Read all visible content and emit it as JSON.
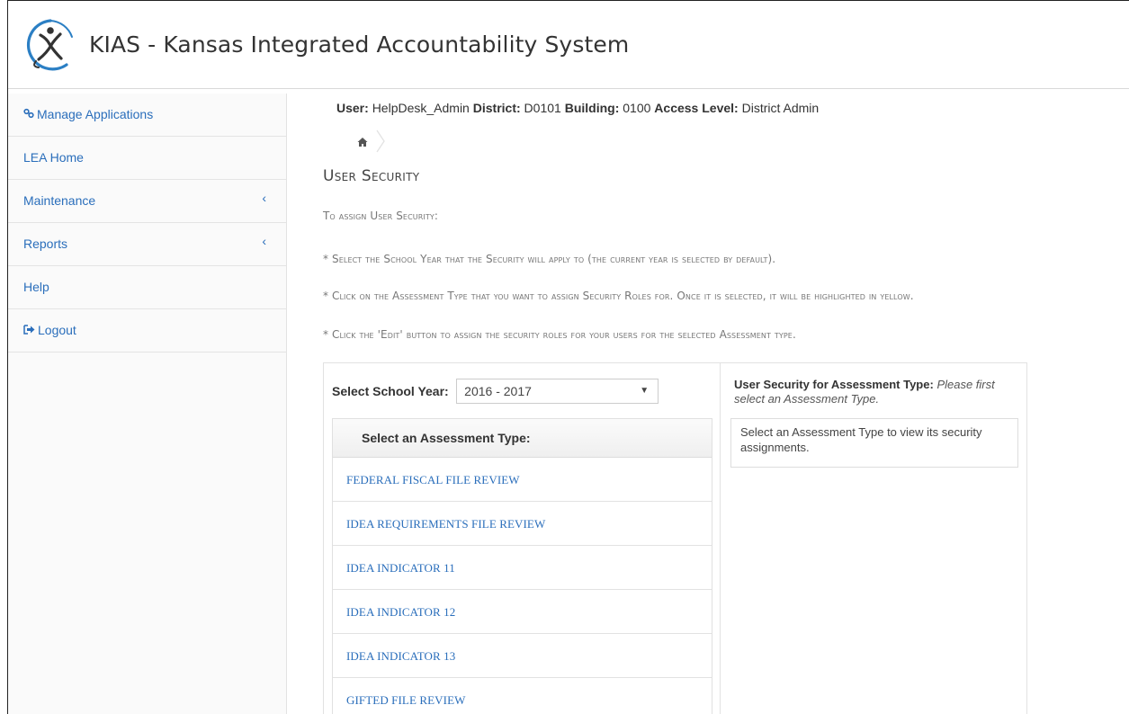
{
  "header": {
    "title": "KIAS - Kansas Integrated Accountability System"
  },
  "sidebar": {
    "items": [
      {
        "label": "Manage Applications",
        "icon": "link-icon"
      },
      {
        "label": "LEA Home"
      },
      {
        "label": "Maintenance",
        "chevron": "‹"
      },
      {
        "label": "Reports",
        "chevron": "‹"
      },
      {
        "label": "Help"
      },
      {
        "label": "Logout",
        "icon": "logout-icon"
      }
    ]
  },
  "user_info": {
    "user_label": "User:",
    "user_value": "HelpDesk_Admin",
    "district_label": "District:",
    "district_value": "D0101",
    "building_label": "Building:",
    "building_value": "0100",
    "access_label": "Access Level:",
    "access_value": "District Admin"
  },
  "page": {
    "title": "User Security",
    "instructions": [
      "To assign User Security:",
      "* Select the School Year that the Security will apply to (the current year is selected by default).",
      "* Click on the Assessment Type that you want to assign Security Roles for. Once it is selected, it will be highlighted in yellow.",
      "* Click the 'Edit' button to assign the security roles for your users for the selected Assessment type."
    ]
  },
  "year_select": {
    "label": "Select School Year:",
    "value": "2016 - 2017"
  },
  "assessment": {
    "header": "Select an Assessment Type:",
    "items": [
      "FEDERAL FISCAL FILE REVIEW",
      "IDEA REQUIREMENTS FILE REVIEW",
      "IDEA INDICATOR 11",
      "IDEA INDICATOR 12",
      "IDEA INDICATOR 13",
      "GIFTED FILE REVIEW"
    ]
  },
  "security_panel": {
    "title_bold": "User Security for Assessment Type:",
    "title_italic": "Please first select an Assessment Type.",
    "message": "Select an Assessment Type to view its security assignments."
  },
  "colors": {
    "link": "#2a6ebb",
    "logo_blue": "#2b7fc4"
  }
}
